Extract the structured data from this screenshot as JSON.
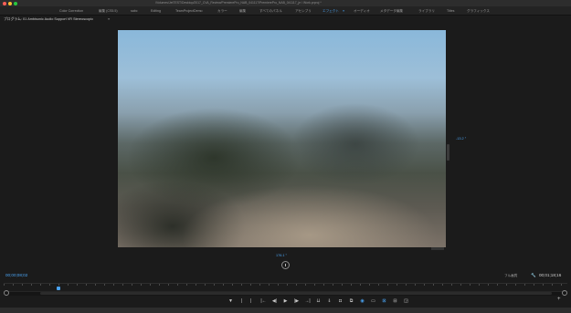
{
  "window": {
    "title": "/Volumes/JetTEST/Desktop/2017_CVA_Review/PremierePro_NAB_041117/PremierePro_NAB_041117_je / Work.prproj *"
  },
  "workspaces": {
    "tabs": [
      {
        "label": "Color Correction",
        "active": false
      },
      {
        "label": "編集 (CS5.5)",
        "active": false
      },
      {
        "label": "sabc",
        "active": false
      },
      {
        "label": "Editing",
        "active": false
      },
      {
        "label": "TeamProjectDemo",
        "active": false
      },
      {
        "label": "カラー",
        "active": false
      },
      {
        "label": "編集",
        "active": false
      },
      {
        "label": "すべてのパネル",
        "active": false
      },
      {
        "label": "アセンブリ",
        "active": false
      },
      {
        "label": "エフェクト",
        "active": true
      },
      {
        "label": "オーディオ",
        "active": false
      },
      {
        "label": "メタデータ編集",
        "active": false
      },
      {
        "label": "ライブラリ",
        "active": false
      },
      {
        "label": "Titles",
        "active": false
      },
      {
        "label": "グラフィックス",
        "active": false
      }
    ],
    "active_menu_icon": "≡",
    "accent_color": "#4aa3f2"
  },
  "program_monitor": {
    "title": "プログラム: 01 Ambisonic Audio Support VR Stereoscopic",
    "menu_icon": "≡",
    "pan_value": "-13.2 °",
    "tilt_value": "176.1 °",
    "timecode_current": "00;00;08;02",
    "quality": "フル画質",
    "timecode_duration": "00;01;18;16"
  },
  "transport": {
    "buttons": [
      {
        "name": "add-marker-button",
        "glyph": "▼",
        "blue": false
      },
      {
        "name": "mark-in-button",
        "glyph": "|",
        "blue": false
      },
      {
        "name": "mark-out-button",
        "glyph": "|",
        "blue": false
      },
      {
        "name": "go-to-in-button",
        "glyph": "|←",
        "blue": false
      },
      {
        "name": "step-back-button",
        "glyph": "◀|",
        "blue": false
      },
      {
        "name": "play-button",
        "glyph": "▶",
        "blue": false
      },
      {
        "name": "step-forward-button",
        "glyph": "|▶",
        "blue": false
      },
      {
        "name": "go-to-out-button",
        "glyph": "→|",
        "blue": false
      },
      {
        "name": "insert-button",
        "glyph": "⇊",
        "blue": false
      },
      {
        "name": "overwrite-button",
        "glyph": "⇓",
        "blue": false
      },
      {
        "name": "export-frame-button",
        "glyph": "◘",
        "blue": false
      },
      {
        "name": "button-editor-button",
        "glyph": "⧉",
        "blue": false
      },
      {
        "name": "vr-video-toggle-button",
        "glyph": "◉",
        "blue": true
      },
      {
        "name": "safe-margins-button",
        "glyph": "▭",
        "blue": false
      },
      {
        "name": "multi-camera-button",
        "glyph": "⊠",
        "blue": true
      },
      {
        "name": "comparison-view-button",
        "glyph": "⊟",
        "blue": false
      },
      {
        "name": "toggle-proxies-button",
        "glyph": "◲",
        "blue": false
      }
    ],
    "add_button": "+"
  }
}
